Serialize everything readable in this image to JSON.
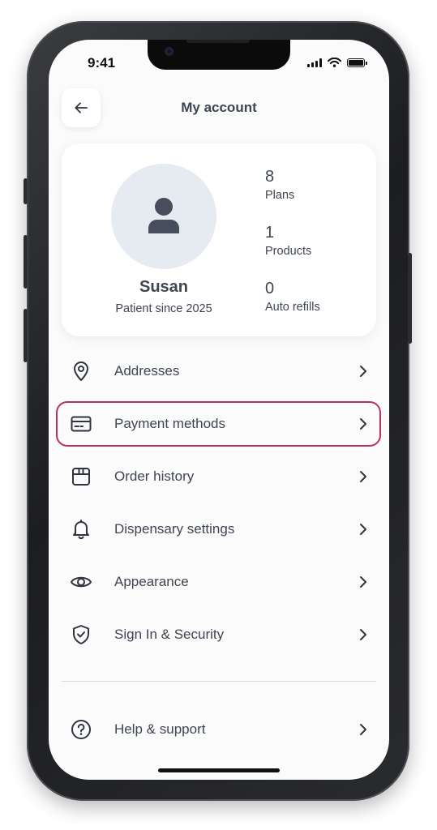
{
  "status_bar": {
    "time": "9:41"
  },
  "header": {
    "title": "My account",
    "back_icon": "arrow-left-icon"
  },
  "profile": {
    "name": "Susan",
    "subtitle": "Patient since 2025",
    "avatar_icon": "person-icon",
    "stats": [
      {
        "value": "8",
        "label": "Plans"
      },
      {
        "value": "1",
        "label": "Products"
      },
      {
        "value": "0",
        "label": "Auto refills"
      }
    ]
  },
  "menu": [
    {
      "label": "Addresses",
      "icon": "map-pin-icon"
    },
    {
      "label": "Payment methods",
      "icon": "credit-card-icon",
      "highlighted": true
    },
    {
      "label": "Order history",
      "icon": "box-icon"
    },
    {
      "label": "Dispensary settings",
      "icon": "bell-icon"
    },
    {
      "label": "Appearance",
      "icon": "eye-icon"
    },
    {
      "label": "Sign In & Security",
      "icon": "shield-check-icon"
    }
  ],
  "support": {
    "label": "Help & support",
    "icon": "help-circle-icon"
  },
  "colors": {
    "text": "#3e4553",
    "highlight": "#b8325a",
    "avatar_bg": "#e6ebf2",
    "screen_bg": "#fbfbfb"
  }
}
